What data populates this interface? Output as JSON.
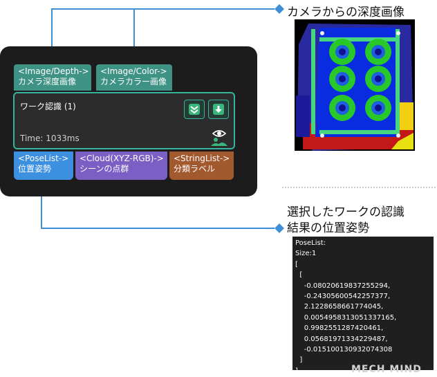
{
  "node": {
    "inputs": [
      {
        "type": "<Image/Depth->",
        "label": "カメラ深度画像"
      },
      {
        "type": "<Image/Color->",
        "label": "カメラカラー画像"
      }
    ],
    "title": "ワーク認識 (1)",
    "time": "Time: 1033ms",
    "outputs": [
      {
        "type": "<PoseList->",
        "label": "位置姿勢",
        "color": "#3d8fe0"
      },
      {
        "type": "<Cloud(XYZ-RGB)->",
        "label": "シーンの点群",
        "color": "#7b5fc4"
      },
      {
        "type": "<StringList->",
        "label": "分類ラベル",
        "color": "#a3592e"
      }
    ]
  },
  "annotations": {
    "depth_caption": "カメラからの深度画像",
    "result_caption_line1": "選択したワークの認識",
    "result_caption_line2": "結果の位置姿勢"
  },
  "poselist_text": {
    "header": "PoseList:",
    "size": "Size:1",
    "lines": [
      "[",
      "  [",
      "    -0.08020619837255294,",
      "    -0.24305600542257377,",
      "    2.1228658661774045,",
      "    0.0054958313051337165,",
      "    0.9982551287420461,",
      "    0.05681971334229487,",
      "    -0.015100130932074308",
      "  ]",
      "]"
    ]
  },
  "watermark": "MECH MIND",
  "colors": {
    "accent": "#3f8fd6",
    "node_bg": "#1c1c1c",
    "input_port": "#3e9385",
    "panel_border": "#35b49e"
  },
  "icons": [
    "down-chevron-icon",
    "download-arrow-icon",
    "eye-person-icon"
  ]
}
